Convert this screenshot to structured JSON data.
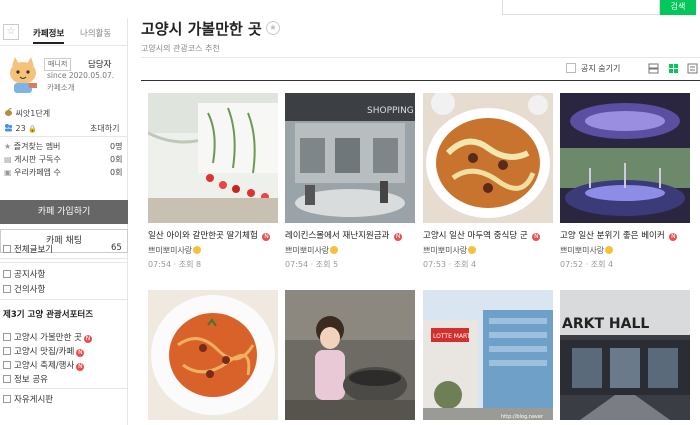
{
  "search": {
    "button_label": "검색",
    "placeholder": ""
  },
  "sidebar": {
    "tabs": [
      "카페정보",
      "나의활동"
    ],
    "profile": {
      "role_badge": "매니저",
      "nickname": "담당자",
      "since": "since 2020.05.07.",
      "intro_link": "카페소개"
    },
    "level": "씨앗1단계",
    "members_count": "23",
    "invite_label": "초대하기",
    "stats": [
      {
        "label": "즐겨찾는 멤버",
        "value": "0명"
      },
      {
        "label": "게시판 구독수",
        "value": "0회"
      },
      {
        "label": "우리카페앱 수",
        "value": "0회"
      }
    ],
    "join_button": "카페 가입하기",
    "chat_button": "카페 채팅",
    "all_posts": {
      "label": "전체글보기",
      "count": "65"
    },
    "menu_group1": [
      {
        "label": "공지사항"
      },
      {
        "label": "건의사항"
      }
    ],
    "group_title": "제3기 고양 관광서포터즈",
    "menu_group2": [
      {
        "label": "고양시 가볼만한 곳",
        "new": true
      },
      {
        "label": "고양시 맛집/카페",
        "new": true
      },
      {
        "label": "고양시 축제/행사",
        "new": true
      },
      {
        "label": "정보 공유",
        "new": false
      }
    ],
    "free_board": "자유게시판"
  },
  "main": {
    "title": "고양시 가볼만한 곳",
    "subtitle": "고양시의 관광코스 추천",
    "notice_toggle_label": "공지 숨기기"
  },
  "cards": [
    {
      "title": "일산 아이와 갈만한곳 딸기체험",
      "author": "쁘미뽀미사랑",
      "time": "07:54",
      "views": "조회 8",
      "new": true
    },
    {
      "title": "레이킨스몰에서 재난지원금과",
      "author": "쁘미뽀미사랑",
      "time": "07:54",
      "views": "조회 5",
      "new": true
    },
    {
      "title": "고양시 일산 마두역 중식당 군",
      "author": "쁘미뽀미사랑",
      "time": "07:53",
      "views": "조회 4",
      "new": true
    },
    {
      "title": "고양 일산 분위기 좋은 베이커",
      "author": "쁘미뽀미사랑",
      "time": "07:52",
      "views": "조회 4",
      "new": true
    },
    {
      "title": "",
      "author": "",
      "time": "",
      "views": "",
      "new": false
    },
    {
      "title": "",
      "author": "",
      "time": "",
      "views": "",
      "new": false
    },
    {
      "title": "",
      "author": "",
      "time": "",
      "views": "",
      "new": false
    },
    {
      "title": "",
      "author": "",
      "time": "",
      "views": "",
      "new": false
    }
  ],
  "image_overlays": {
    "mall_sign": "SHOPPING",
    "market_sign": "ARKT HALL",
    "lotte_sign": "LOTTE MART",
    "watermark": "http://blog.naver"
  },
  "colors": {
    "accent": "#03c75a",
    "new_badge": "#e85050",
    "join_button": "#666666"
  }
}
